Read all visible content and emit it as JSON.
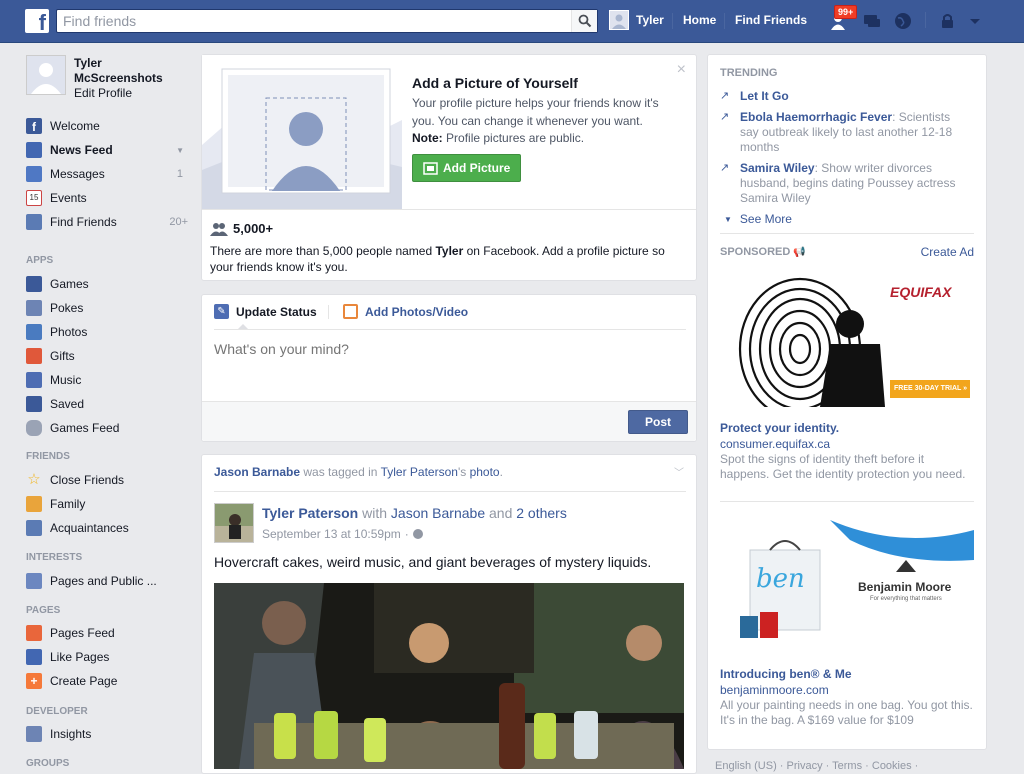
{
  "topbar": {
    "logo": "f",
    "search_placeholder": "Find friends",
    "user_name": "Tyler",
    "home": "Home",
    "find_friends": "Find Friends",
    "notif_badge": "99+"
  },
  "left": {
    "profile_name": "Tyler McScreenshots",
    "edit_profile": "Edit Profile",
    "main_items": [
      {
        "label": "Welcome",
        "count": ""
      },
      {
        "label": "News Feed",
        "count": ""
      },
      {
        "label": "Messages",
        "count": "1"
      },
      {
        "label": "Events",
        "count": ""
      },
      {
        "label": "Find Friends",
        "count": "20+"
      }
    ],
    "apps_title": "APPS",
    "apps": [
      {
        "label": "Games"
      },
      {
        "label": "Pokes"
      },
      {
        "label": "Photos"
      },
      {
        "label": "Gifts"
      },
      {
        "label": "Music"
      },
      {
        "label": "Saved"
      },
      {
        "label": "Games Feed"
      }
    ],
    "friends_title": "FRIENDS",
    "friends": [
      {
        "label": "Close Friends"
      },
      {
        "label": "Family"
      },
      {
        "label": "Acquaintances"
      }
    ],
    "interests_title": "INTERESTS",
    "interests": [
      {
        "label": "Pages and Public ..."
      }
    ],
    "pages_title": "PAGES",
    "pages": [
      {
        "label": "Pages Feed"
      },
      {
        "label": "Like Pages"
      },
      {
        "label": "Create Page"
      }
    ],
    "developer_title": "DEVELOPER",
    "developer": [
      {
        "label": "Insights"
      }
    ],
    "groups_title": "GROUPS"
  },
  "addpic": {
    "title": "Add a Picture of Yourself",
    "desc": "Your profile picture helps your friends know it's you. You can change it whenever you want.",
    "note_label": "Note:",
    "note_text": "Profile pictures are public.",
    "button": "Add Picture",
    "close": "×",
    "count": "5,000+",
    "info_pre": "There are more than 5,000 people named ",
    "info_name": "Tyler",
    "info_post": " on Facebook. Add a profile picture so your friends know it's you."
  },
  "status": {
    "tab_update": "Update Status",
    "tab_photos": "Add Photos/Video",
    "placeholder": "What's on your mind?",
    "post": "Post"
  },
  "story": {
    "tag_actor": "Jason Barnabe",
    "tag_mid": " was tagged in ",
    "tag_owner": "Tyler Paterson",
    "tag_suffix": "'s ",
    "tag_object": "photo",
    "tag_end": ".",
    "author": "Tyler Paterson",
    "with": " with ",
    "with_name": "Jason Barnabe",
    "and": " and ",
    "others": "2 others",
    "time": "September 13 at 10:59pm",
    "text": "Hovercraft cakes, weird music, and giant beverages of mystery liquids."
  },
  "right": {
    "trending_title": "TRENDING",
    "trending": [
      {
        "topic": "Let It Go",
        "desc": ""
      },
      {
        "topic": "Ebola Haemorrhagic Fever",
        "desc": ": Scientists say outbreak likely to last another 12-18 months"
      },
      {
        "topic": "Samira Wiley",
        "desc": ": Show writer divorces husband, begins dating Poussey actress Samira Wiley"
      }
    ],
    "see_more": "See More",
    "sponsored_title": "SPONSORED",
    "create_ad": "Create Ad",
    "ads": [
      {
        "brand": "EQUIFAX",
        "promo": "FREE 30-DAY TRIAL »",
        "title": "Protect your identity.",
        "url": "consumer.equifax.ca",
        "desc": "Spot the signs of identity theft before it happens. Get the identity protection you need."
      },
      {
        "brand": "Benjamin Moore",
        "tagline": "For everything that matters",
        "ben": "ben",
        "title": "Introducing ben® & Me",
        "url": "benjaminmoore.com",
        "desc": "All your painting needs in one bag. You got this. It's in the bag. A $169 value for $109"
      }
    ],
    "footer": "English (US) · Privacy · Terms · Cookies ·"
  },
  "colors": {
    "brand": "#3b5998",
    "green": "#4cae4c",
    "badge": "#f03d25"
  }
}
